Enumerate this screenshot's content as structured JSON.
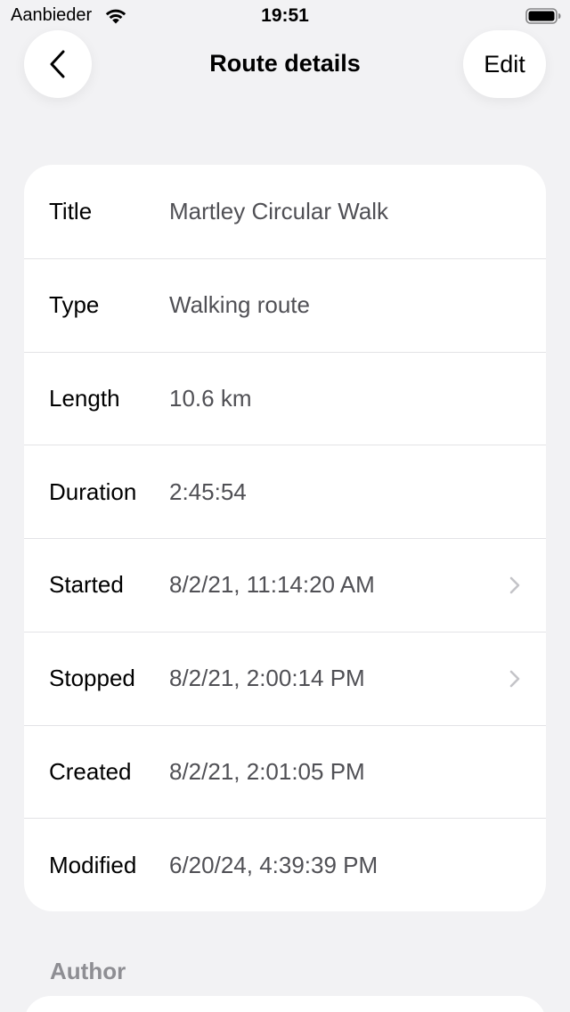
{
  "status_bar": {
    "carrier": "Aanbieder",
    "time": "19:51"
  },
  "nav": {
    "title": "Route details",
    "edit_label": "Edit"
  },
  "details": [
    {
      "label": "Title",
      "value": "Martley Circular Walk",
      "chevron": false
    },
    {
      "label": "Type",
      "value": "Walking route",
      "chevron": false
    },
    {
      "label": "Length",
      "value": "10.6 km",
      "chevron": false
    },
    {
      "label": "Duration",
      "value": "2:45:54",
      "chevron": false
    },
    {
      "label": "Started",
      "value": "8/2/21, 11:14:20 AM",
      "chevron": true
    },
    {
      "label": "Stopped",
      "value": "8/2/21, 2:00:14 PM",
      "chevron": true
    },
    {
      "label": "Created",
      "value": "8/2/21, 2:01:05 PM",
      "chevron": false
    },
    {
      "label": "Modified",
      "value": "6/20/24, 4:39:39 PM",
      "chevron": false
    }
  ],
  "author_section": {
    "header": "Author"
  },
  "colors": {
    "background": "#f2f2f4",
    "card": "#ffffff",
    "value_text": "#505055",
    "section_header": "#8e8e93",
    "chevron": "#c4c4c8"
  }
}
